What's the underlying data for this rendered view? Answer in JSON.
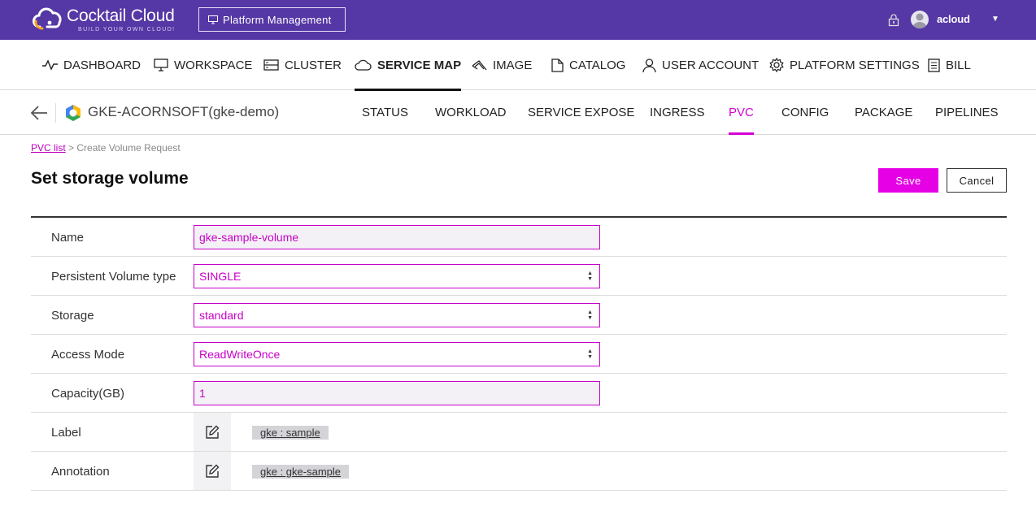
{
  "app": {
    "logo_title": "Cocktail Cloud",
    "logo_tagline": "BUILD YOUR OWN CLOUD!",
    "platform_button": "Platform Management",
    "user_name": "acloud",
    "user_caret": "▼",
    "brand_color": "#5537a5",
    "accent_color": "#e600e6"
  },
  "main_nav": [
    {
      "label": "DASHBOARD",
      "icon": "pulse-icon"
    },
    {
      "label": "WORKSPACE",
      "icon": "monitor-icon"
    },
    {
      "label": "CLUSTER",
      "icon": "server-icon"
    },
    {
      "label": "SERVICE MAP",
      "icon": "cloud-icon",
      "active": true
    },
    {
      "label": "IMAGE",
      "icon": "image-icon"
    },
    {
      "label": "CATALOG",
      "icon": "document-icon"
    },
    {
      "label": "USER ACCOUNT",
      "icon": "user-icon"
    },
    {
      "label": "PLATFORM SETTINGS",
      "icon": "gear-icon"
    },
    {
      "label": "BILL",
      "icon": "bill-icon"
    }
  ],
  "sub_nav": {
    "cluster_name": "GKE-ACORNSOFT(gke-demo)",
    "tabs": [
      {
        "label": "STATUS"
      },
      {
        "label": "WORKLOAD"
      },
      {
        "label": "SERVICE EXPOSE"
      },
      {
        "label": "INGRESS"
      },
      {
        "label": "PVC",
        "active": true
      },
      {
        "label": "CONFIG"
      },
      {
        "label": "PACKAGE"
      },
      {
        "label": "PIPELINES"
      }
    ]
  },
  "breadcrumb": {
    "link": "PVC list",
    "current": " > Create Volume Request"
  },
  "page": {
    "title": "Set storage volume",
    "save_label": "Save",
    "cancel_label": "Cancel"
  },
  "form": {
    "name_label": "Name",
    "name_value": "gke-sample-volume",
    "pv_type_label": "Persistent Volume type",
    "pv_type_value": "SINGLE",
    "storage_label": "Storage",
    "storage_value": "standard",
    "access_mode_label": "Access Mode",
    "access_mode_value": "ReadWriteOnce",
    "capacity_label": "Capacity(GB)",
    "capacity_value": "1",
    "label_label": "Label",
    "label_tag": "gke : sample",
    "annotation_label": "Annotation",
    "annotation_tag": "gke : gke-sample"
  }
}
